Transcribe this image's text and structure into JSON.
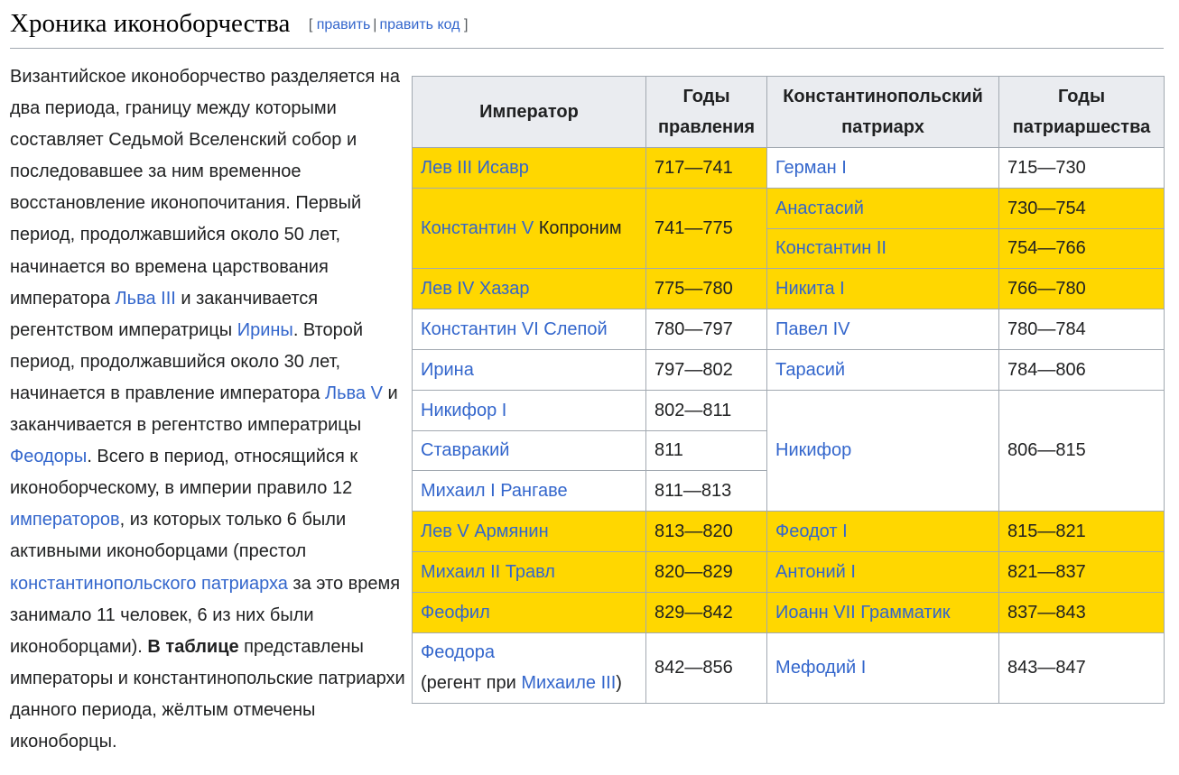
{
  "heading": {
    "title": "Хроника иконоборчества",
    "edit": "править",
    "edit_code": "править код",
    "bracket_open": "[",
    "bracket_close": "]",
    "separator": "|"
  },
  "paragraph": {
    "t1": "Византийское иконоборчество разделяется на два периода, границу между которыми составляет Седьмой Вселенский собор и последовавшее за ним временное восстановление иконопочитания. Первый период, продолжавшийся около 50 лет, начинается во времена царствования императора ",
    "l1": "Льва III",
    "t2": " и заканчивается регентством императрицы ",
    "l2": "Ирины",
    "t3": ". Второй период, продолжавшийся около 30 лет, начинается в правление императора ",
    "l3": "Льва V",
    "t4": " и заканчивается в регентство императрицы ",
    "l4": "Феодоры",
    "t5": ". Всего в период, относящийся к иконоборческому, в империи правило 12 ",
    "l5": "императоров",
    "t6": ", из которых только 6 были активными иконоборцами (престол ",
    "l6": "константинопольского патриарха",
    "t7": " за это время занимало 11 человек, 6 из них были иконоборцами). ",
    "b1": "В таблице",
    "t8": " представлены императоры и константинопольские патриархи данного периода, жёлтым отмечены иконоборцы."
  },
  "table": {
    "headers": [
      "Император",
      "Годы правления",
      "Константинопольский патриарх",
      "Годы патриаршества"
    ],
    "rows": [
      {
        "emperor": "Лев III Исавр",
        "reign": "717—741",
        "patriarch": "Герман I",
        "patriarchate": "715—730"
      },
      {
        "emperor": "Константин V",
        "emperor_extra": " Копроним",
        "reign": "741—775",
        "patriarch": "Анастасий",
        "patriarchate": "730—754"
      },
      {
        "patriarch": "Константин II",
        "patriarchate": "754—766"
      },
      {
        "emperor": "Лев IV Хазар",
        "reign": "775—780",
        "patriarch": "Никита I",
        "patriarchate": "766—780"
      },
      {
        "emperor": "Константин VI Слепой",
        "reign": "780—797",
        "patriarch": "Павел IV",
        "patriarchate": "780—784"
      },
      {
        "emperor": "Ирина",
        "reign": "797—802",
        "patriarch": "Тарасий",
        "patriarchate": "784—806"
      },
      {
        "emperor": "Никифор I",
        "reign": "802—811",
        "patriarch": "Никифор",
        "patriarchate": "806—815"
      },
      {
        "emperor": "Ставракий",
        "reign": "811"
      },
      {
        "emperor": "Михаил I Рангаве",
        "reign": "811—813"
      },
      {
        "emperor": "Лев V Армянин",
        "reign": "813—820",
        "patriarch": "Феодот I",
        "patriarchate": "815—821"
      },
      {
        "emperor": "Михаил II Травл",
        "reign": "820—829",
        "patriarch": "Антоний I",
        "patriarchate": "821—837"
      },
      {
        "emperor": "Феофил",
        "reign": "829—842",
        "patriarch": "Иоанн VII Грамматик",
        "patriarchate": "837—843"
      },
      {
        "emperor": "Феодора",
        "emperor_note_pre": "(регент при ",
        "emperor_note_link": "Михаиле III",
        "emperor_note_post": ")",
        "reign": "842—856",
        "patriarch": "Мефодий I",
        "patriarchate": "843—847"
      }
    ]
  },
  "colors": {
    "iconoclast_highlight": "#ffd700",
    "link": "#3366cc",
    "header_bg": "#eaecf0",
    "border": "#a2a9b1"
  }
}
